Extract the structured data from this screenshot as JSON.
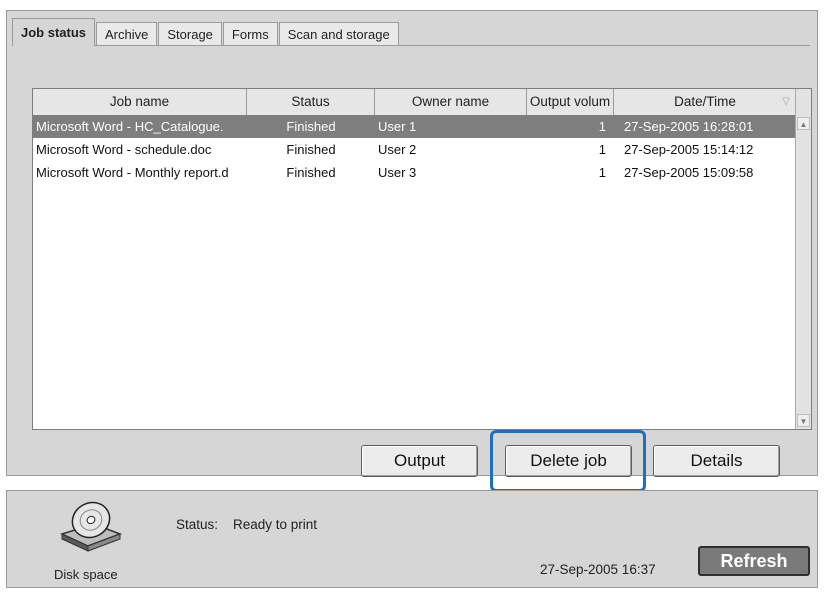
{
  "tabs": [
    "Job status",
    "Archive",
    "Storage",
    "Forms",
    "Scan and storage"
  ],
  "table": {
    "columns": [
      "Job name",
      "Status",
      "Owner name",
      "Output volum",
      "Date/Time"
    ],
    "rows": [
      [
        "Microsoft Word - HC_Catalogue.",
        "Finished",
        "User 1",
        "1",
        "27-Sep-2005 16:28:01"
      ],
      [
        "Microsoft Word - schedule.doc",
        "Finished",
        "User 2",
        "1",
        "27-Sep-2005 15:14:12"
      ],
      [
        "Microsoft Word - Monthly report.d",
        "Finished",
        "User 3",
        "1",
        "27-Sep-2005 15:09:58"
      ]
    ],
    "selected_row": 0
  },
  "actions": {
    "output": "Output",
    "delete": "Delete job",
    "details": "Details"
  },
  "status_bar": {
    "disk_label": "Disk space",
    "status_label": "Status:",
    "status_value": "Ready to print",
    "datetime": "27-Sep-2005 16:37",
    "refresh": "Refresh"
  },
  "colors": {
    "highlight": "#1f6fbf",
    "selected_row": "#7e7e7e"
  },
  "icons": {
    "disk": "disk-drive-icon",
    "sort": "sort-descending-icon"
  }
}
